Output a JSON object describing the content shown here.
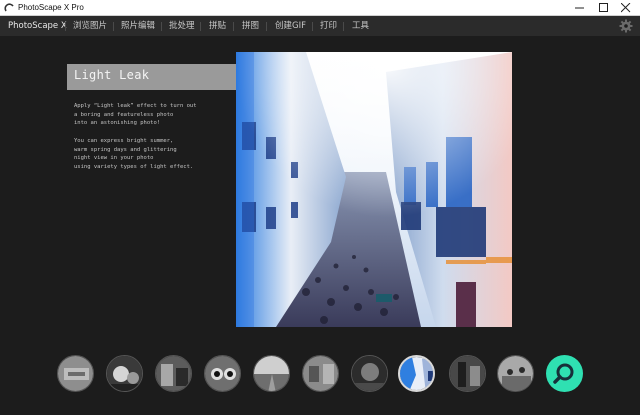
{
  "window": {
    "title": "PhotoScape X Pro"
  },
  "menu": {
    "items": [
      {
        "label": "PhotoScape X",
        "active": true
      },
      {
        "label": "浏览图片",
        "active": false
      },
      {
        "label": "照片编辑",
        "active": false
      },
      {
        "label": "批处理",
        "active": false
      },
      {
        "label": "拼贴",
        "active": false
      },
      {
        "label": "拼图",
        "active": false
      },
      {
        "label": "创建GIF",
        "active": false
      },
      {
        "label": "打印",
        "active": false
      },
      {
        "label": "工具",
        "active": false
      }
    ]
  },
  "feature": {
    "title": "Light Leak",
    "description_1": "Apply “Light leak” effect to turn out\na boring and featureless photo\ninto an astonishing photo!",
    "description_2": "You can express bright summer,\nwarm spring days and glittering\nnight view in your photo\nusing variety types of light effect."
  },
  "thumbnails": {
    "count": 10,
    "selected_index": 7
  },
  "colors": {
    "background": "#1c1c1c",
    "menubar": "#2b2b2b",
    "accent": "#2fe0b2",
    "heading_box": "#9a9a9a"
  },
  "icons": [
    "app-icon",
    "minimize-icon",
    "maximize-icon",
    "close-icon",
    "settings-gear-icon",
    "search-icon"
  ]
}
